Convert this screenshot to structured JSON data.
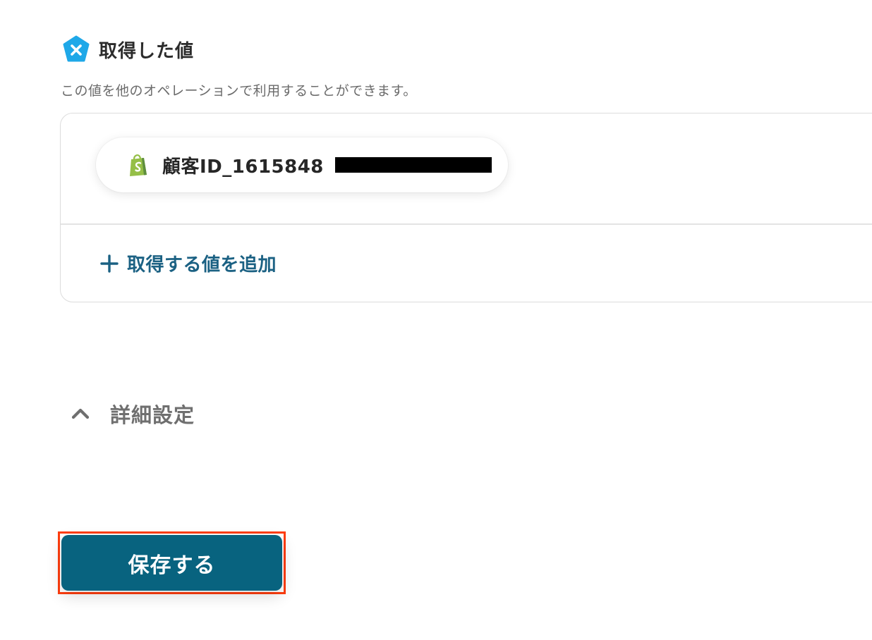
{
  "section": {
    "title": "取得した値",
    "description": "この値を他のオペレーションで利用することができます。",
    "icon": "yoom-x-badge-icon",
    "icon_color": "#1fa8e8"
  },
  "values": [
    {
      "label": "顧客ID_1615848",
      "source_icon": "shopify-icon",
      "value_redacted": true
    }
  ],
  "add_value": {
    "label": "取得する値を追加",
    "icon": "plus-icon"
  },
  "advanced_settings": {
    "label": "詳細設定",
    "icon": "chevron-up-icon",
    "expanded": true
  },
  "save_button": {
    "label": "保存する",
    "color": "#08637f"
  },
  "colors": {
    "accent": "#1b6183",
    "highlight_border": "#ff3d0e",
    "shopify_green": "#95bf47"
  }
}
